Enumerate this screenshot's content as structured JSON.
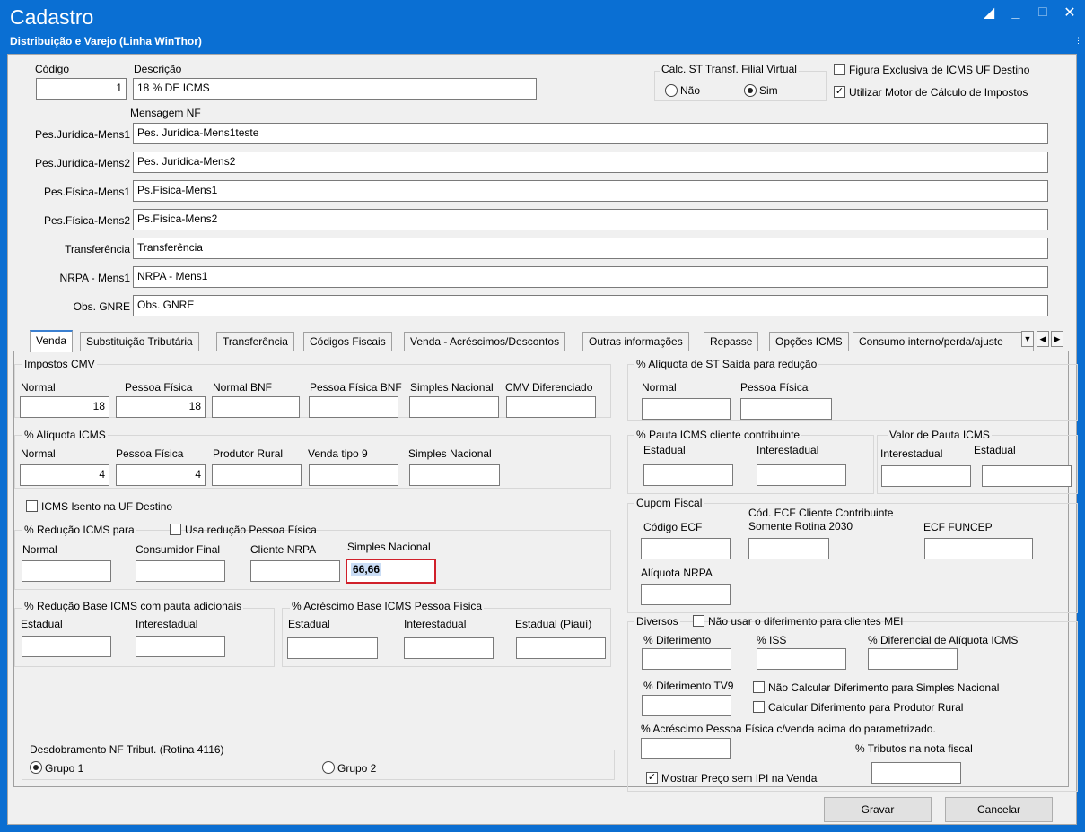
{
  "window": {
    "title": "Cadastro",
    "subtitle": "Distribuição e Varejo (Linha WinThor)",
    "controls": [
      "restore-icon",
      "minimize-icon",
      "maximize-icon",
      "close-icon"
    ],
    "more_glyph": "⋮"
  },
  "header": {
    "codigo_label": "Código",
    "codigo_value": "1",
    "descricao_label": "Descrição",
    "descricao_value": "18 % DE ICMS",
    "calc_st": {
      "title": "Calc. ST Transf. Filial Virtual",
      "opt_nao": "Não",
      "opt_sim": "Sim",
      "selected": "Sim"
    },
    "figura_exclusiva": {
      "label": "Figura Exclusiva de ICMS UF Destino",
      "checked": false
    },
    "utilizar_motor": {
      "label": "Utilizar Motor de Cálculo de Impostos",
      "checked": true
    },
    "mensagem_nf_label": "Mensagem NF",
    "messages": [
      {
        "label": "Pes.Jurídica-Mens1",
        "value": "Pes. Jurídica-Mens1teste"
      },
      {
        "label": "Pes.Jurídica-Mens2",
        "value": "Pes. Jurídica-Mens2"
      },
      {
        "label": "Pes.Física-Mens1",
        "value": "Ps.Física-Mens1"
      },
      {
        "label": "Pes.Física-Mens2",
        "value": "Ps.Física-Mens2"
      },
      {
        "label": "Transferência",
        "value": "Transferência"
      },
      {
        "label": "NRPA - Mens1",
        "value": "NRPA - Mens1"
      },
      {
        "label": "Obs. GNRE",
        "value": "Obs. GNRE"
      }
    ]
  },
  "tabs": [
    "Venda",
    "Substituição Tributária",
    "Transferência",
    "Códigos Fiscais",
    "Venda - Acréscimos/Descontos",
    "Outras informações",
    "Repasse",
    "Opções ICMS",
    "Consumo interno/perda/ajuste"
  ],
  "active_tab": "Venda",
  "impostos_cmv": {
    "title": "Impostos CMV",
    "labels": [
      "Normal",
      "Pessoa Física",
      "Normal BNF",
      "Pessoa Física BNF",
      "Simples Nacional",
      "CMV Diferenciado"
    ],
    "values": [
      "18",
      "18",
      "",
      "",
      "",
      ""
    ]
  },
  "aliquota_icms": {
    "title": "% Alíquota ICMS",
    "labels": [
      "Normal",
      "Pessoa Física",
      "Produtor Rural",
      "Venda tipo 9",
      "Simples Nacional"
    ],
    "values": [
      "4",
      "4",
      "",
      "",
      ""
    ]
  },
  "icms_isento": {
    "label": "ICMS Isento na UF Destino",
    "checked": false
  },
  "reducao_icms": {
    "title": "% Redução ICMS para",
    "usa_reducao_label": "Usa redução Pessoa Física",
    "labels": [
      "Normal",
      "Consumidor Final",
      "Cliente NRPA",
      "Simples Nacional"
    ],
    "values": [
      "",
      "",
      "",
      "66,66"
    ]
  },
  "reducao_base": {
    "title": "% Redução Base ICMS com pauta adicionais",
    "labels": [
      "Estadual",
      "Interestadual"
    ]
  },
  "acrescimo_base": {
    "title": "% Acréscimo Base ICMS Pessoa Física",
    "labels": [
      "Estadual",
      "Interestadual",
      "Estadual (Piauí)"
    ]
  },
  "desdobramento": {
    "title": "Desdobramento NF Tribut. (Rotina 4116)",
    "opt1": "Grupo 1",
    "opt2": "Grupo 2",
    "selected": "Grupo 1"
  },
  "aliquota_st": {
    "title": "% Alíquota de ST Saída para redução",
    "labels": [
      "Normal",
      "Pessoa Física"
    ]
  },
  "pauta_icms": {
    "title": "% Pauta ICMS cliente contribuinte",
    "labels": [
      "Estadual",
      "Interestadual"
    ]
  },
  "valor_pauta": {
    "title": "Valor de Pauta ICMS",
    "labels": [
      "Interestadual",
      "Estadual"
    ]
  },
  "cupom_fiscal": {
    "title": "Cupom Fiscal",
    "codigo_ecf": "Código ECF",
    "cod_ecf_cliente_1": "Cód. ECF Cliente Contribuinte",
    "cod_ecf_cliente_2": "Somente Rotina 2030",
    "ecf_funcep": "ECF FUNCEP",
    "aliquota_nrpa": "Alíquota NRPA"
  },
  "diversos": {
    "title": "Diversos",
    "nao_usar_diferimento": "Não usar o diferimento para clientes MEI",
    "diferimento": "% Diferimento",
    "iss": "% ISS",
    "diferencial": "% Diferencial de Alíquota ICMS",
    "diferimento_tv9": "% Diferimento TV9",
    "nao_calcular_simples": "Não Calcular Diferimento para Simples Nacional",
    "calcular_produtor": "Calcular Diferimento para Produtor Rural",
    "acrescimo_pf": "% Acréscimo Pessoa Física c/venda acima do parametrizado.",
    "tributos_nota": "% Tributos na nota fiscal",
    "mostrar_preco": "Mostrar Preço sem IPI na Venda",
    "mostrar_preco_checked": true
  },
  "footer": {
    "gravar": "Gravar",
    "cancelar": "Cancelar"
  },
  "colors": {
    "titlebar": "#0a6fd3",
    "highlight_border": "#d0202a"
  }
}
